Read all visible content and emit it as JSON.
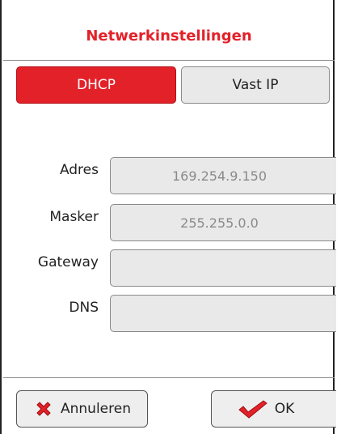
{
  "dialog": {
    "title": "Netwerkinstellingen"
  },
  "mode_tabs": {
    "dhcp_label": "DHCP",
    "static_label": "Vast IP",
    "selected": "DHCP"
  },
  "fields": {
    "address_label": "Adres",
    "address_value": "169.254.9.150",
    "mask_label": "Masker",
    "mask_value": "255.255.0.0",
    "gateway_label": "Gateway",
    "gateway_value": "",
    "dns_label": "DNS",
    "dns_value": ""
  },
  "actions": {
    "cancel_label": "Annuleren",
    "ok_label": "OK"
  },
  "icons": {
    "cancel": "red-x-icon",
    "ok": "red-checkmark-icon"
  },
  "colors": {
    "accent": "#e32129",
    "field_bg": "#e9e9e9",
    "field_text": "#8a8a8a"
  }
}
